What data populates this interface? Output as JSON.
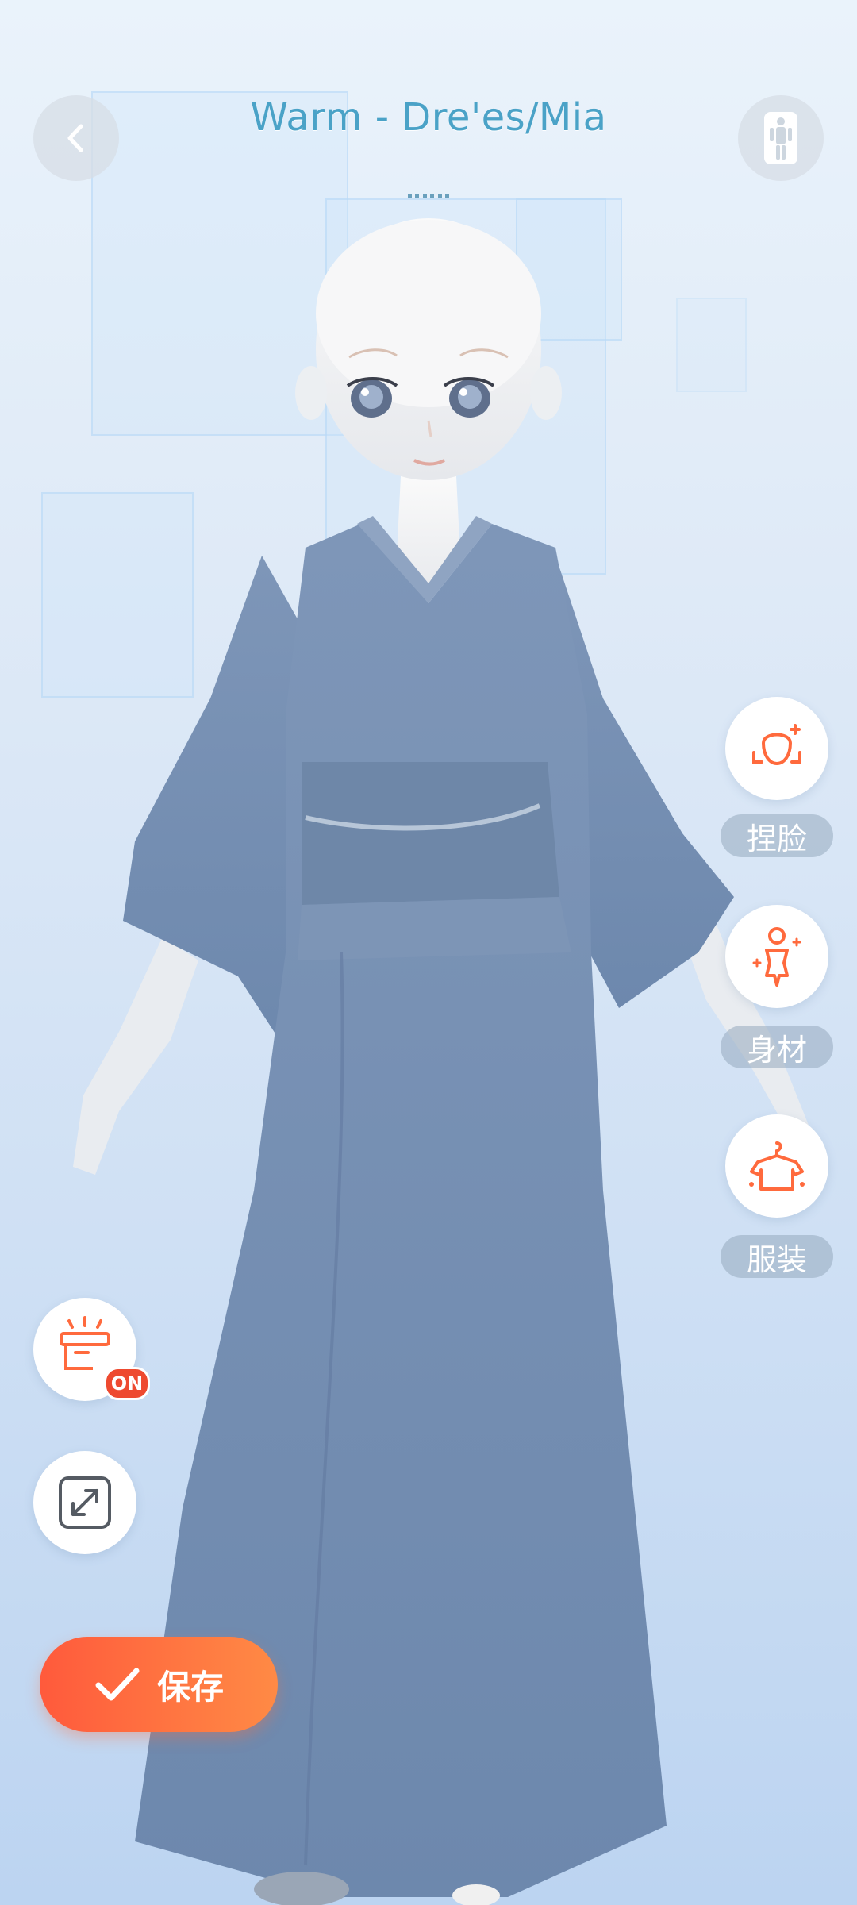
{
  "header": {
    "title": "Warm - Dre'es/Mia",
    "back_icon": "chevron-left-icon",
    "pose_icon": "standing-figure-icon"
  },
  "side_menu": [
    {
      "id": "face",
      "label": "捏脸",
      "icon": "face-sculpt-icon"
    },
    {
      "id": "body",
      "label": "身材",
      "icon": "body-shape-icon"
    },
    {
      "id": "outfit",
      "label": "服装",
      "icon": "hanger-shirt-icon"
    }
  ],
  "left_controls": {
    "lamp_badge": "ON",
    "lamp_icon": "stage-light-icon",
    "expand_icon": "expand-arrows-icon"
  },
  "save_button": {
    "label": "保存",
    "icon": "check-icon"
  },
  "colors": {
    "accent": "#ff6a3d",
    "title": "#4aa2c7",
    "label_bg": "#96aabe"
  }
}
